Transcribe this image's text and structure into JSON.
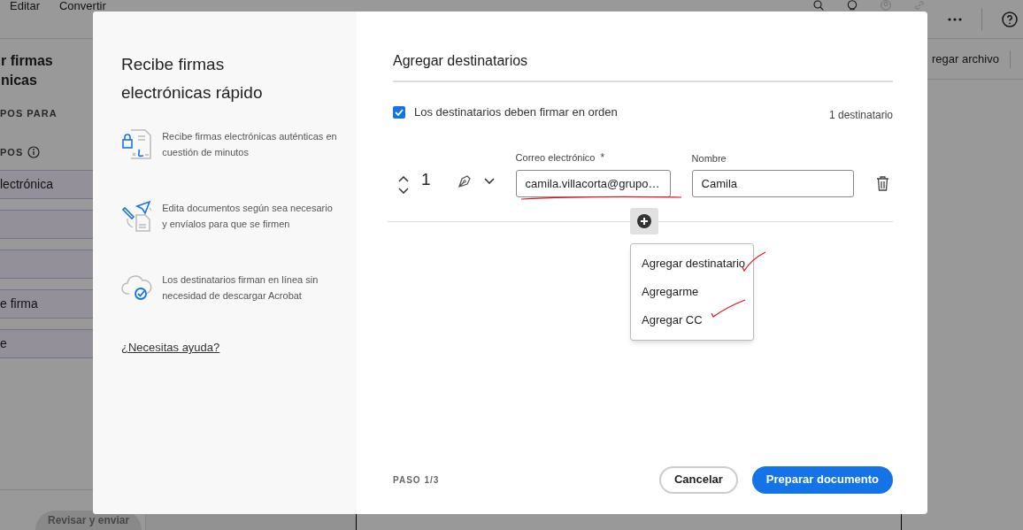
{
  "top_bar": {
    "menu": [
      {
        "label": "Editar"
      },
      {
        "label": "Convertir"
      }
    ]
  },
  "left_panel": {
    "title_lines": [
      "r firmas",
      "nicas"
    ],
    "section": "POS PARA",
    "subsection": "POS",
    "items": [
      {
        "kind": "text",
        "label": "lectrónica"
      },
      {
        "kind": "blank"
      },
      {
        "kind": "blank"
      },
      {
        "kind": "text",
        "label": "e firma"
      },
      {
        "kind": "text",
        "label": "e"
      }
    ],
    "review_button": {
      "label": "Revisar y enviar",
      "disabled": true
    }
  },
  "right_toolbar": {
    "add_file": "regar archivo"
  },
  "dialog": {
    "intro": {
      "title": "Recibe firmas electrónicas rápido",
      "features": [
        {
          "text": "Recibe firmas electrónicas auténticas en cuestión de minutos"
        },
        {
          "text": "Edita documentos según sea necesario y envíalos para que se firmen"
        },
        {
          "text": "Los destinatarios firman en línea sin necesidad de descargar Acrobat"
        }
      ],
      "help_link": "¿Necesitas ayuda?"
    },
    "heading": "Agregar destinatarios",
    "order_checkbox": {
      "label": "Los destinatarios deben firmar en orden",
      "checked": true
    },
    "recipient_count": "1 destinatario",
    "recipient": {
      "number": "1",
      "email_label": "Correo electrónico",
      "required_mark": "*",
      "email_value": "camila.villacorta@grupo…",
      "name_label": "Nombre",
      "name_value": "Camila"
    },
    "add_menu": [
      {
        "label": "Agregar destinatario"
      },
      {
        "label": "Agregarme"
      },
      {
        "label": "Agregar CC"
      }
    ],
    "step": "PASO 1/3",
    "cancel_button": "Cancelar",
    "primary_button": "Preparar documento"
  }
}
